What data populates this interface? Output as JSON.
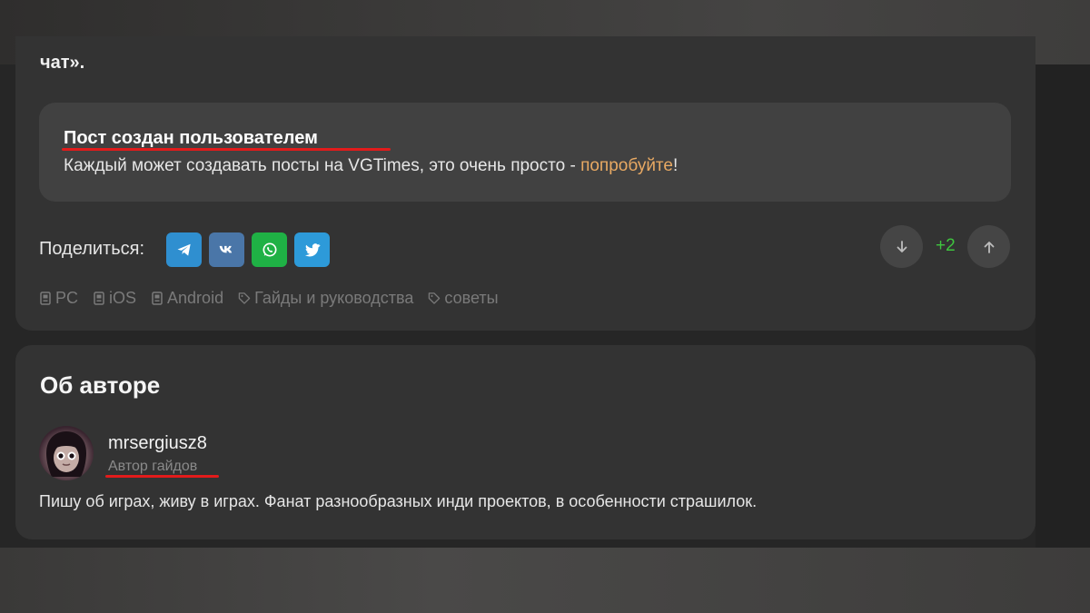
{
  "post": {
    "intro_tail": "чат».",
    "notice": {
      "title": "Пост создан пользователем",
      "text": "Каждый может создавать посты на VGTimes, это очень просто - ",
      "link": "попробуйте",
      "suffix": "!"
    }
  },
  "share": {
    "label": "Поделиться:",
    "buttons": [
      {
        "name": "telegram",
        "icon": "telegram-icon",
        "color": "#2f8fd0"
      },
      {
        "name": "vk",
        "icon": "vk-icon",
        "color": "#4a76a8"
      },
      {
        "name": "whatsapp",
        "icon": "whatsapp-icon",
        "color": "#1fb145"
      },
      {
        "name": "twitter",
        "icon": "twitter-icon",
        "color": "#2d9ad9"
      }
    ]
  },
  "rating": {
    "score": "+2",
    "score_color": "#3fc53f"
  },
  "tags": [
    {
      "label": "PC",
      "icon": "device-icon"
    },
    {
      "label": "iOS",
      "icon": "device-icon"
    },
    {
      "label": "Android",
      "icon": "device-icon"
    },
    {
      "label": "Гайды и руководства",
      "icon": "tag-icon"
    },
    {
      "label": "советы",
      "icon": "tag-icon"
    }
  ],
  "author": {
    "heading": "Об авторе",
    "name": "mrsergiusz8",
    "role": "Автор гайдов",
    "bio": "Пишу об играх, живу в играх. Фанат разнообразных инди проектов, в особенности страшилок."
  },
  "colors": {
    "accent_link": "#e8a963",
    "annotation_underline": "#e21b1b",
    "card_bg": "#333333"
  }
}
